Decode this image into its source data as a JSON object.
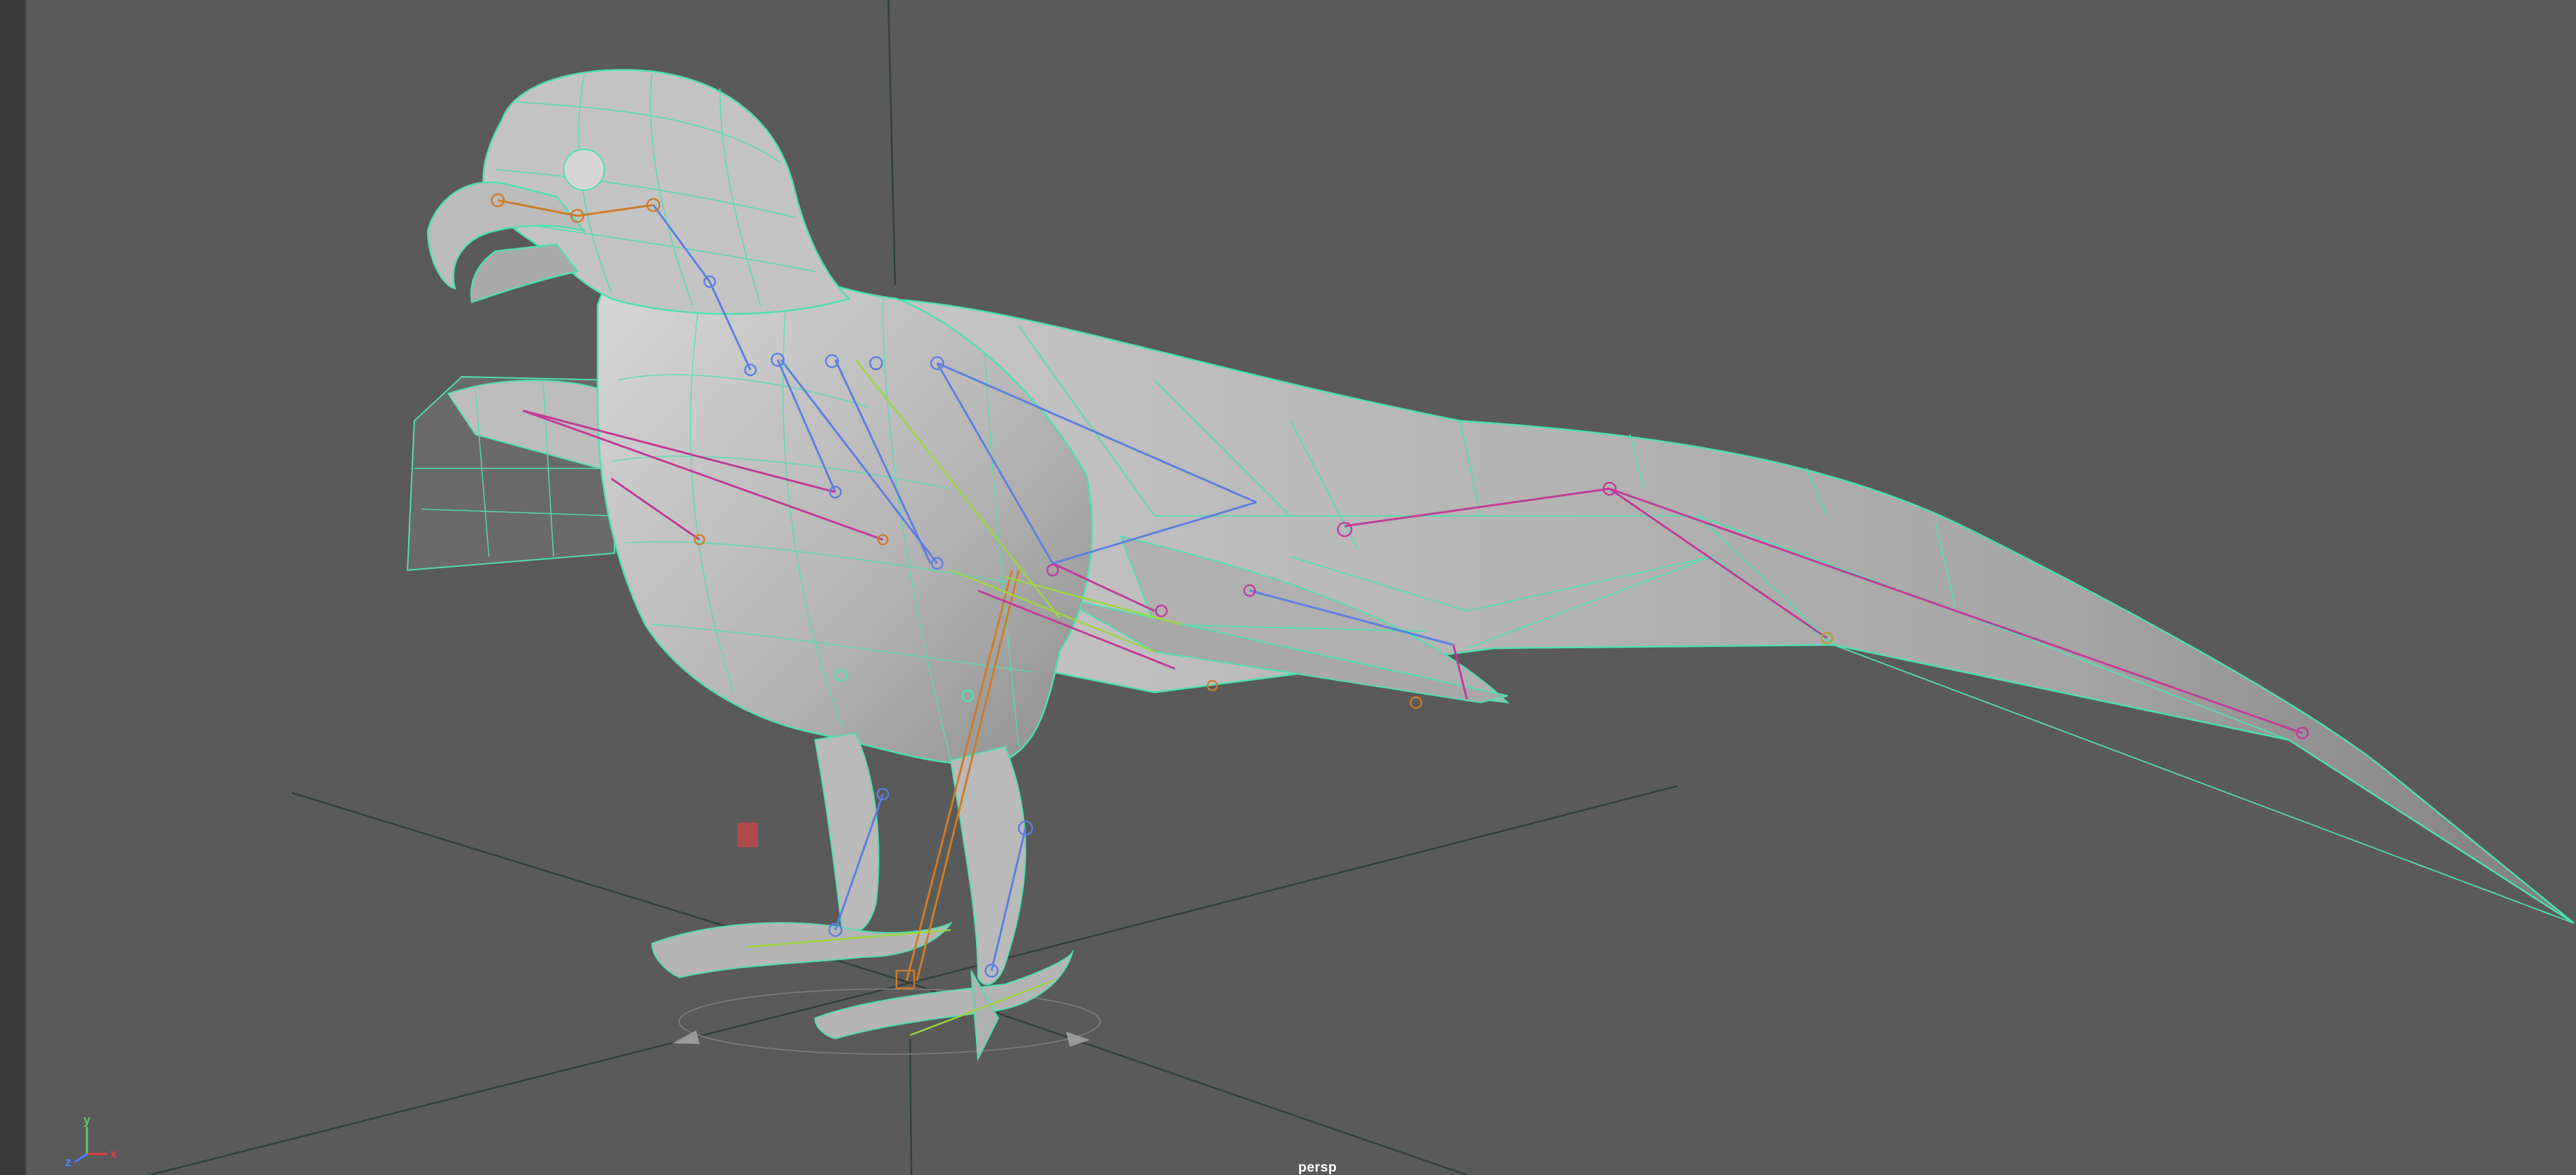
{
  "viewport": {
    "camera_name": "persp",
    "background_color": "#5a5a5a",
    "grid_color": "#2f3f3c",
    "wireframe_color": "#4ee0b0",
    "mesh_shade_color": "#c9c9c9"
  },
  "axis_gizmo": {
    "x_label": "x",
    "y_label": "y",
    "z_label": "z",
    "x_color": "#e04040",
    "y_color": "#60d060",
    "z_color": "#5080ff"
  },
  "scene": {
    "model": "bird-mesh",
    "skeleton_colors": {
      "spine": "#5a7fe0",
      "wing": "#c03a9a",
      "neck": "#d07a2a",
      "leg": "#5a7fe0",
      "ik": "#9bd93a"
    },
    "locator_color": "#c04848"
  }
}
